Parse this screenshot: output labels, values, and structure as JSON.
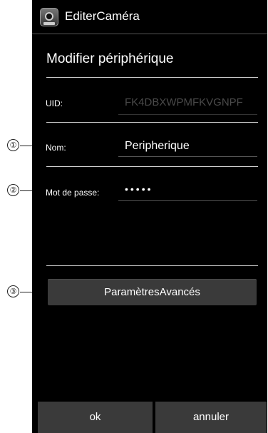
{
  "app": {
    "title": "EditerCaméra"
  },
  "dialog": {
    "title": "Modifier périphérique"
  },
  "fields": {
    "uid": {
      "label": "UID:",
      "value": "FK4DBXWPMFKVGNPF"
    },
    "name": {
      "label": "Nom:",
      "value": "Peripherique"
    },
    "password": {
      "label": "Mot de passe:",
      "value": "•••••"
    }
  },
  "buttons": {
    "advanced": "ParamètresAvancés",
    "ok": "ok",
    "cancel": "annuler"
  },
  "callouts": [
    "①",
    "②",
    "③"
  ],
  "colors": {
    "background": "#000000",
    "button": "#3a3a3a",
    "text": "#ffffff",
    "disabled_text": "#4a4a4a"
  }
}
